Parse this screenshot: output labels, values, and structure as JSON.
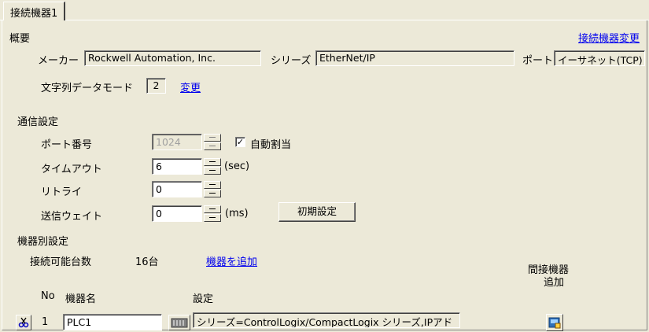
{
  "tab": {
    "label": "接続機器1"
  },
  "overview": {
    "heading": "概要",
    "change_device_link": "接続機器変更",
    "maker_label": "メーカー",
    "maker_value": "Rockwell Automation, Inc.",
    "series_label": "シリーズ",
    "series_value": "EtherNet/IP",
    "port_label": "ポート",
    "port_value": "イーサネット(TCP)",
    "string_mode_label": "文字列データモード",
    "string_mode_value": "2",
    "change_link": "変更"
  },
  "comm": {
    "heading": "通信設定",
    "port_no_label": "ポート番号",
    "port_no_value": "1024",
    "auto_assign_label": "自動割当",
    "auto_assign_checked": true,
    "timeout_label": "タイムアウト",
    "timeout_value": "6",
    "timeout_unit": "(sec)",
    "retry_label": "リトライ",
    "retry_value": "0",
    "send_wait_label": "送信ウェイト",
    "send_wait_value": "0",
    "send_wait_unit": "(ms)",
    "default_button": "初期設定"
  },
  "device_settings": {
    "heading": "機器別設定",
    "connectable_label": "接続可能台数",
    "connectable_value": "16台",
    "add_device_link": "機器を追加",
    "columns": {
      "no": "No",
      "name": "機器名",
      "setting": "設定",
      "indirect_line1": "間接機器",
      "indirect_line2": "追加"
    },
    "rows": [
      {
        "no": "1",
        "name": "PLC1",
        "setting": "シリーズ=ControlLogix/CompactLogix シリーズ,IPアド"
      }
    ]
  }
}
